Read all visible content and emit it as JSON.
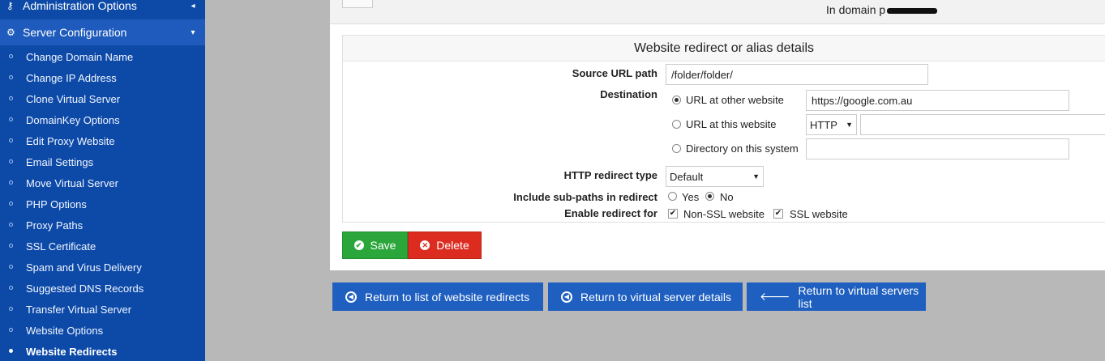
{
  "sidebar": {
    "admin_label": "Administration Options",
    "admin_chevron": "◂",
    "server_label": "Server Configuration",
    "server_chevron": "▾",
    "items": [
      {
        "label": "Change Domain Name"
      },
      {
        "label": "Change IP Address"
      },
      {
        "label": "Clone Virtual Server"
      },
      {
        "label": "DomainKey Options"
      },
      {
        "label": "Edit Proxy Website"
      },
      {
        "label": "Email Settings"
      },
      {
        "label": "Move Virtual Server"
      },
      {
        "label": "PHP Options"
      },
      {
        "label": "Proxy Paths"
      },
      {
        "label": "SSL Certificate"
      },
      {
        "label": "Spam and Virus Delivery"
      },
      {
        "label": "Suggested DNS Records"
      },
      {
        "label": "Transfer Virtual Server"
      },
      {
        "label": "Website Options"
      },
      {
        "label": "Website Redirects",
        "active": true
      }
    ]
  },
  "header": {
    "domain_prefix": "In domain",
    "domain_visible_fragment": "p"
  },
  "form": {
    "title": "Website redirect or alias details",
    "source_label": "Source URL path",
    "source_value": "/folder/folder/",
    "destination_label": "Destination",
    "dest_opt_other": "URL at other website",
    "dest_other_value": "https://google.com.au",
    "dest_opt_this": "URL at this website",
    "protocol_value": "HTTP",
    "dest_this_value": "",
    "dest_opt_dir": "Directory on this system",
    "dest_dir_value": "",
    "redirect_type_label": "HTTP redirect type",
    "redirect_type_value": "Default",
    "subpaths_label": "Include sub-paths in redirect",
    "subpaths_yes": "Yes",
    "subpaths_no": "No",
    "subpaths_selected": "No",
    "enable_label": "Enable redirect for",
    "enable_nonssl": "Non-SSL website",
    "enable_ssl": "SSL website",
    "nonssl_checked": true,
    "ssl_checked": true
  },
  "actions": {
    "save": "Save",
    "delete": "Delete"
  },
  "returns": {
    "redirects": "Return to list of website redirects",
    "server_details": "Return to virtual server details",
    "servers_list": "Return to virtual servers list"
  },
  "colors": {
    "sidebar_bg": "#0d4aa8",
    "save_green": "#2aa63a",
    "delete_red": "#dc2c20",
    "return_blue": "#1e5fc0",
    "page_bg": "#b8b8b8"
  },
  "icons": {
    "admin": "key-gear-icon",
    "server": "gears-icon",
    "save": "check-circle-icon",
    "delete": "times-circle-icon",
    "return_redirects": "circle-arrow-left-icon",
    "return_details": "circle-arrow-left-icon",
    "return_list": "arrow-left-icon"
  }
}
